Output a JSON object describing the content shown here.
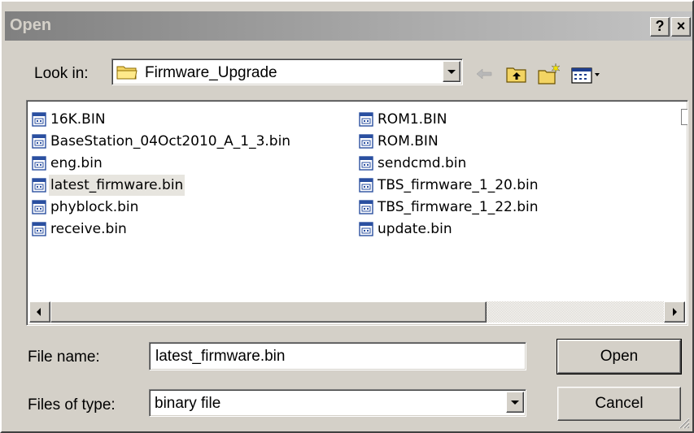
{
  "window": {
    "title": "Open",
    "help_label": "?",
    "close_label": "×"
  },
  "look_in": {
    "label": "Look in:",
    "value": "Firmware_Upgrade",
    "folder_icon": "folder-icon"
  },
  "toolbar": {
    "icons": [
      "back-arrow-icon",
      "up-folder-icon",
      "new-folder-icon",
      "view-menu-icon"
    ]
  },
  "file_list": {
    "file_icon": "binary-file-icon",
    "selected": "latest_firmware.bin",
    "column1": [
      "16K.BIN",
      "BaseStation_04Oct2010_A_1_3.bin",
      "eng.bin",
      "latest_firmware.bin",
      "phyblock.bin",
      "receive.bin"
    ],
    "column2": [
      "ROM1.BIN",
      "ROM.BIN",
      "sendcmd.bin",
      "TBS_firmware_1_20.bin",
      "TBS_firmware_1_22.bin",
      "update.bin"
    ]
  },
  "file_name": {
    "label": "File name:",
    "value": "latest_firmware.bin"
  },
  "file_type": {
    "label": "Files of type:",
    "value": "binary file"
  },
  "buttons": {
    "open_label": "Open",
    "cancel_label": "Cancel"
  }
}
